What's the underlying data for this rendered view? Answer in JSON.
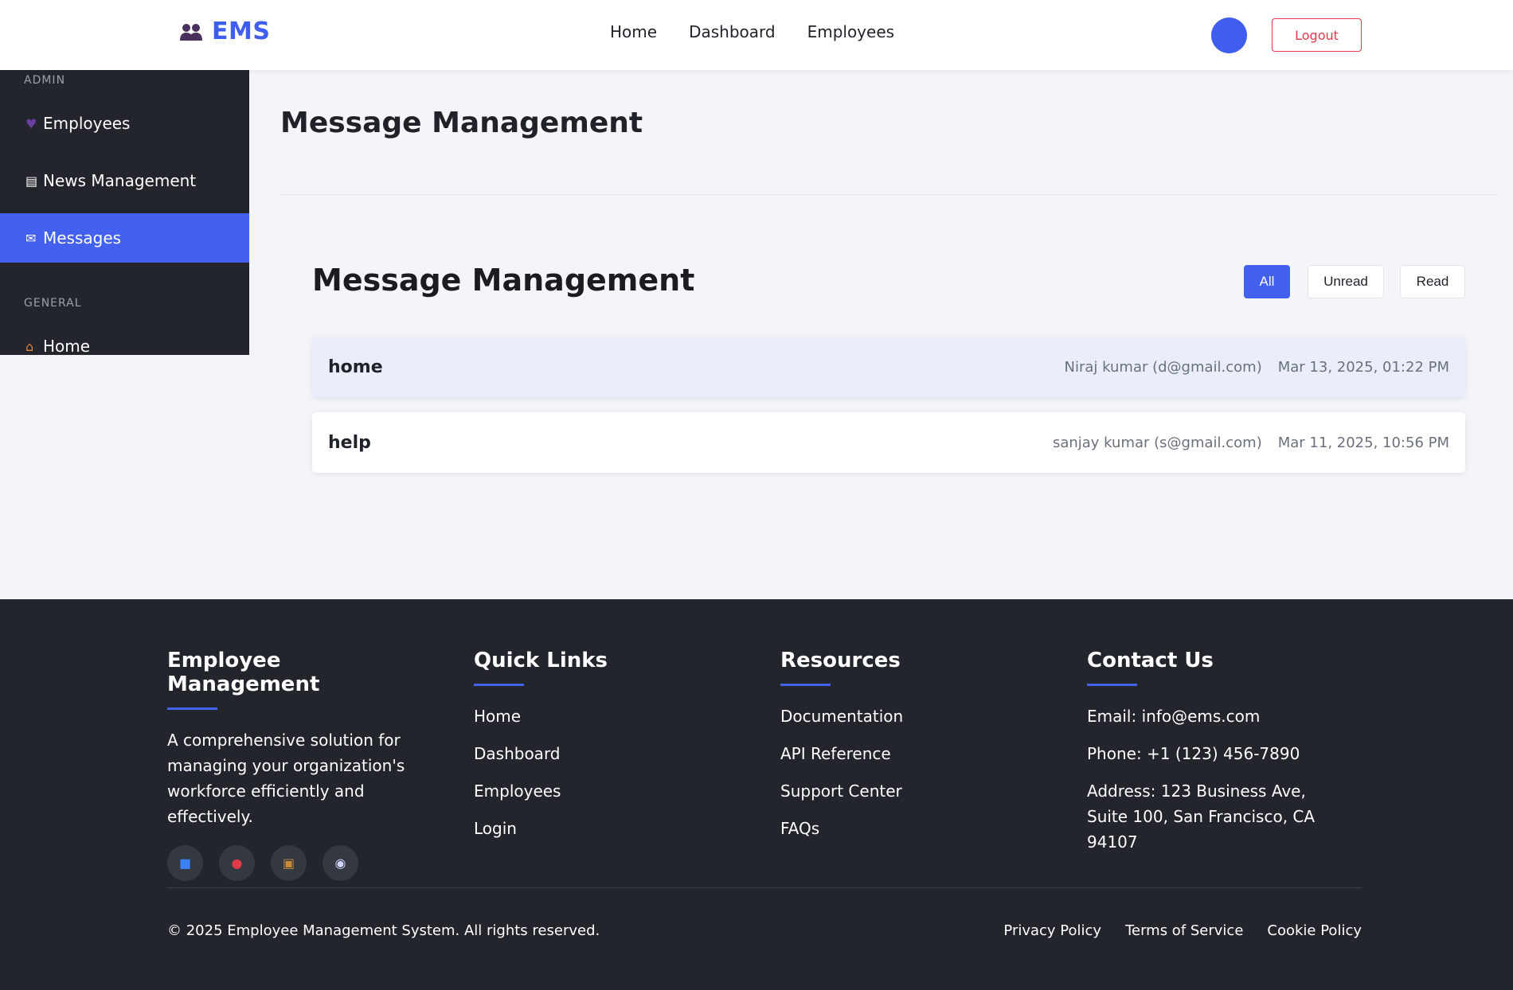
{
  "header": {
    "brand": "EMS",
    "nav": [
      "Home",
      "Dashboard",
      "Employees"
    ],
    "logout_label": "Logout",
    "accent_color": "#4361ee"
  },
  "sidebar": {
    "admin_label": "ADMIN",
    "general_label": "GENERAL",
    "items": [
      {
        "icon": "people-icon",
        "label": "Employees"
      },
      {
        "icon": "newspaper-icon",
        "label": "News Management"
      },
      {
        "icon": "envelope-icon",
        "label": "Messages",
        "active": true
      },
      {
        "icon": "house-icon",
        "label": "Home"
      }
    ]
  },
  "main": {
    "page_title": "Message Management",
    "section_title": "Message Management",
    "filters": [
      "All",
      "Unread",
      "Read"
    ],
    "active_filter": "All",
    "messages": [
      {
        "subject": "home",
        "sender": "Niraj kumar (d@gmail.com)",
        "date": "Mar 13, 2025, 01:22 PM",
        "unread": true
      },
      {
        "subject": "help",
        "sender": "sanjay kumar (s@gmail.com)",
        "date": "Mar 11, 2025, 10:56 PM",
        "unread": false
      }
    ]
  },
  "footer": {
    "about": {
      "title": "Employee Management",
      "text": "A comprehensive solution for managing your organization's workforce efficiently and effectively.",
      "social_icons": [
        "facebook-icon",
        "twitter-icon",
        "linkedin-icon",
        "instagram-icon"
      ]
    },
    "quick_links": {
      "title": "Quick Links",
      "links": [
        "Home",
        "Dashboard",
        "Employees",
        "Login"
      ]
    },
    "resources": {
      "title": "Resources",
      "links": [
        "Documentation",
        "API Reference",
        "Support Center",
        "FAQs"
      ]
    },
    "contact": {
      "title": "Contact Us",
      "email": "Email: info@ems.com",
      "phone": "Phone: +1 (123) 456-7890",
      "address": "Address: 123 Business Ave, Suite 100, San Francisco, CA 94107"
    },
    "copyright": "© 2025 Employee Management System. All rights reserved.",
    "legal": [
      "Privacy Policy",
      "Terms of Service",
      "Cookie Policy"
    ]
  }
}
